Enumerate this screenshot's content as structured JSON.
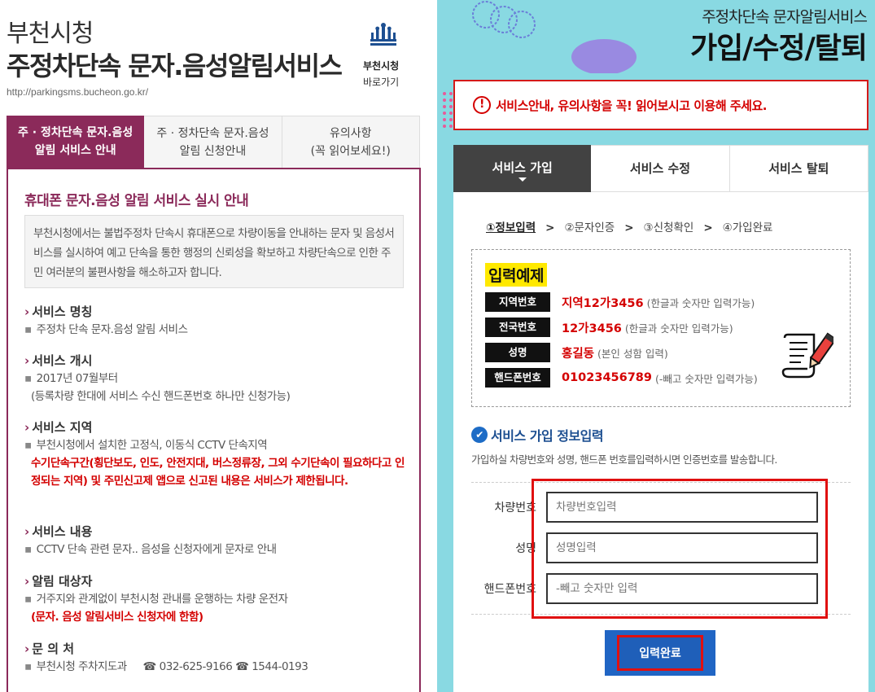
{
  "left": {
    "city": "부천시청",
    "title": "주정차단속 문자.음성알림서비스",
    "url": "http://parkingsms.bucheon.go.kr/",
    "logo_name": "부천시청",
    "logo_link": "바로가기",
    "tabs": [
      {
        "line1": "주 · 정차단속 문자.음성",
        "line2": "알림 서비스 안내"
      },
      {
        "line1": "주 · 정차단속 문자.음성",
        "line2": "알림 신청안내"
      },
      {
        "line1": "유의사항",
        "line2": "(꼭 읽어보세요!)"
      }
    ],
    "heading": "휴대폰 문자.음성 알림 서비스 실시 안내",
    "intro": "부천시청에서는 불법주정차 단속시 휴대폰으로 차량이동을 안내하는 문자 및 음성서비스를 실시하여 예고 단속을 통한 행정의 신뢰성을 확보하고 차량단속으로 인한 주민 여러분의 불편사항을 해소하고자 합니다.",
    "sections": {
      "name": {
        "title": "서비스 명칭",
        "line1": "주정차 단속 문자.음성 알림 서비스"
      },
      "start": {
        "title": "서비스 개시",
        "line1": "2017년 07월부터",
        "line2": "(등록차량 한대에 서비스 수신 핸드폰번호 하나만 신청가능)"
      },
      "area": {
        "title": "서비스 지역",
        "line1": "부천시청에서 설치한 고정식, 이동식 CCTV 단속지역",
        "red": "수기단속구간(횡단보도, 인도, 안전지대, 버스정류장, 그외 수기단속이 필요하다고 인정되는 지역) 및 주민신고제 앱으로 신고된 내용은 서비스가 제한됩니다."
      },
      "content": {
        "title": "서비스 내용",
        "line1": "CCTV 단속 관련 문자.. 음성을 신청자에게 문자로 안내"
      },
      "target": {
        "title": "알림 대상자",
        "line1": "거주지와 관계없이 부천시청 관내를 운행하는 차량 운전자",
        "red": "(문자. 음성 알림서비스 신청자에 한함)"
      },
      "contact": {
        "title": "문 의 처",
        "line1": "부천시청 주차지도과",
        "phone1": "032-625-9166",
        "phone2": "1544-0193"
      }
    }
  },
  "right": {
    "subtitle": "주정차단속 문자알림서비스",
    "title": "가입/수정/탈퇴",
    "warning": "서비스안내, 유의사항을 꼭! 읽어보시고 이용해 주세요.",
    "tabs": [
      "서비스 가입",
      "서비스 수정",
      "서비스 탈퇴"
    ],
    "steps": [
      "①정보입력",
      "②문자인증",
      "③신청확인",
      "④가입완료"
    ],
    "example": {
      "title": "입력예제",
      "rows": [
        {
          "label": "지역번호",
          "value": "지역12가3456",
          "note": "(한글과 숫자만 입력가능)"
        },
        {
          "label": "전국번호",
          "value": "12가3456",
          "note": "(한글과 숫자만 입력가능)"
        },
        {
          "label": "성명",
          "value": "홍길동",
          "note": "(본인 성함 입력)"
        },
        {
          "label": "핸드폰번호",
          "value": "01023456789",
          "note": "(-빼고 숫자만 입력가능)"
        }
      ]
    },
    "form": {
      "heading": "서비스 가입 정보입력",
      "desc": "가입하실 차량번호와 성명, 핸드폰 번호를입력하시면 인증번호를 발송합니다.",
      "fields": [
        {
          "label": "차량번호",
          "placeholder": "차량번호입력"
        },
        {
          "label": "성명",
          "placeholder": "성명입력"
        },
        {
          "label": "핸드폰번호",
          "placeholder": "-빼고 숫자만 입력"
        }
      ],
      "submit": "입력완료"
    }
  }
}
